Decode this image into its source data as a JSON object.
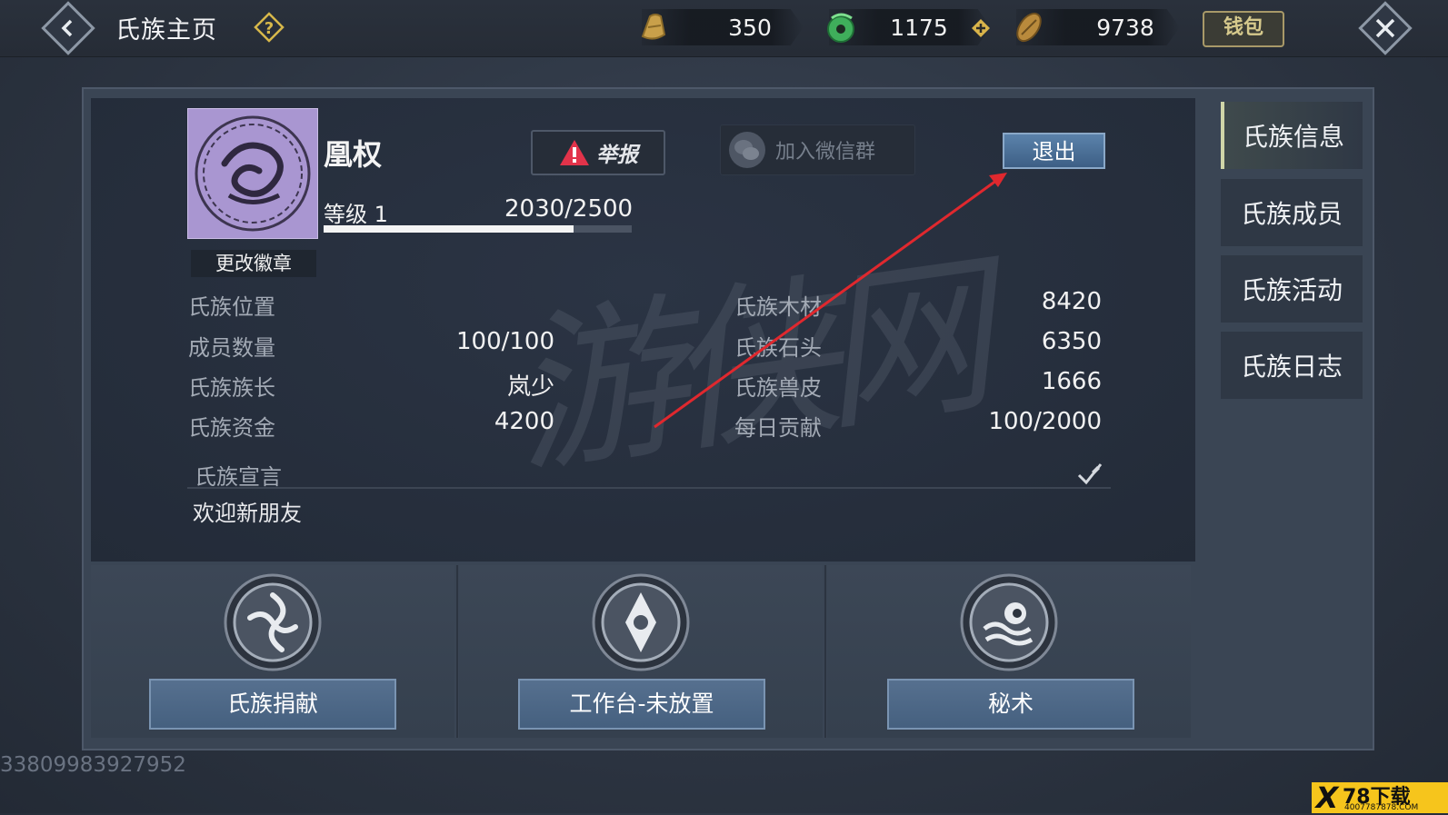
{
  "header": {
    "title": "氏族主页",
    "currencies": [
      {
        "icon": "gold-ingot-icon",
        "amount": "350"
      },
      {
        "icon": "jade-coin-icon",
        "amount": "1175"
      },
      {
        "icon": "copper-coin-icon",
        "amount": "9738"
      }
    ],
    "wallet_label": "钱包"
  },
  "clan": {
    "name": "凰权",
    "level_label": "等级 1",
    "exp_text": "2030/2500",
    "exp_progress": 0.812,
    "change_badge_label": "更改徽章",
    "report_label": "举报",
    "wechat_label": "加入微信群",
    "exit_label": "退出",
    "stats_left": [
      {
        "label": "氏族位置",
        "value": ""
      },
      {
        "label": "成员数量",
        "value": "100/100"
      },
      {
        "label": "氏族族长",
        "value": "岚少"
      },
      {
        "label": "氏族资金",
        "value": "4200"
      }
    ],
    "stats_right": [
      {
        "label": "氏族木材",
        "value": "8420"
      },
      {
        "label": "氏族石头",
        "value": "6350"
      },
      {
        "label": "氏族兽皮",
        "value": "1666"
      },
      {
        "label": "每日贡献",
        "value": "100/2000"
      }
    ],
    "declaration_label": "氏族宣言",
    "declaration_text": "欢迎新朋友"
  },
  "features": [
    {
      "label": "氏族捐献",
      "icon": "donation-emblem-icon"
    },
    {
      "label": "工作台-未放置",
      "icon": "workbench-emblem-icon"
    },
    {
      "label": "秘术",
      "icon": "secret-art-emblem-icon"
    }
  ],
  "tabs": [
    {
      "label": "氏族信息",
      "active": true
    },
    {
      "label": "氏族成员",
      "active": false
    },
    {
      "label": "氏族活动",
      "active": false
    },
    {
      "label": "氏族日志",
      "active": false
    }
  ],
  "user_id": "33809983927952",
  "watermark_text": "游侠网",
  "logo": {
    "main": "78下载",
    "sub": "4007787878.COM"
  },
  "colors": {
    "accent": "#4a6d95",
    "exit_button": "#4f76a0",
    "emblem": "#a996d1",
    "arrow": "#e0282e"
  }
}
